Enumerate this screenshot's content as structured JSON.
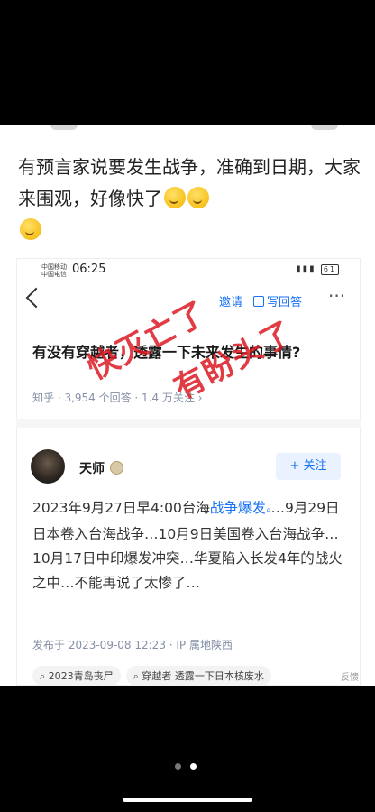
{
  "post": {
    "text": "有预言家说要发生战争，准确到日期，大家来围观，好像快了"
  },
  "screenshot": {
    "status": {
      "carrier_line1": "中国移动",
      "carrier_line2": "中国电信",
      "time": "06:25",
      "battery": "61"
    },
    "nav": {
      "invite": "邀请",
      "write_answer": "写回答",
      "more": "···"
    },
    "question": {
      "title": "有没有穿越者，透露一下未来发生的事情?",
      "meta": "知乎 · 3,954 个回答 · 1.4 万关注 ›"
    },
    "answer": {
      "author": "天师",
      "follow": "+ 关注",
      "text_a": "2023年9月27日早4:00台海",
      "text_highlight": "战争爆发",
      "text_b": "…9月29日日本卷入台海战争…10月9日美国卷入台海战争…10月17日中印爆发冲突…华夏陷入长发4年的战火之中…不能再说了太惨了…",
      "published": "发布于 2023-09-08 12:23 · IP 属地陕西",
      "tags": [
        "2023青岛丧尸",
        "穿越者 透露一下日本核废水"
      ],
      "report": "反馈"
    },
    "stamps": {
      "left": "快灭亡了",
      "right": "有盼头了"
    }
  },
  "pager": {
    "current": 2,
    "total": 2
  },
  "colors": {
    "accent": "#1772f6",
    "stamp": "#dc1923",
    "background": "#000000"
  }
}
